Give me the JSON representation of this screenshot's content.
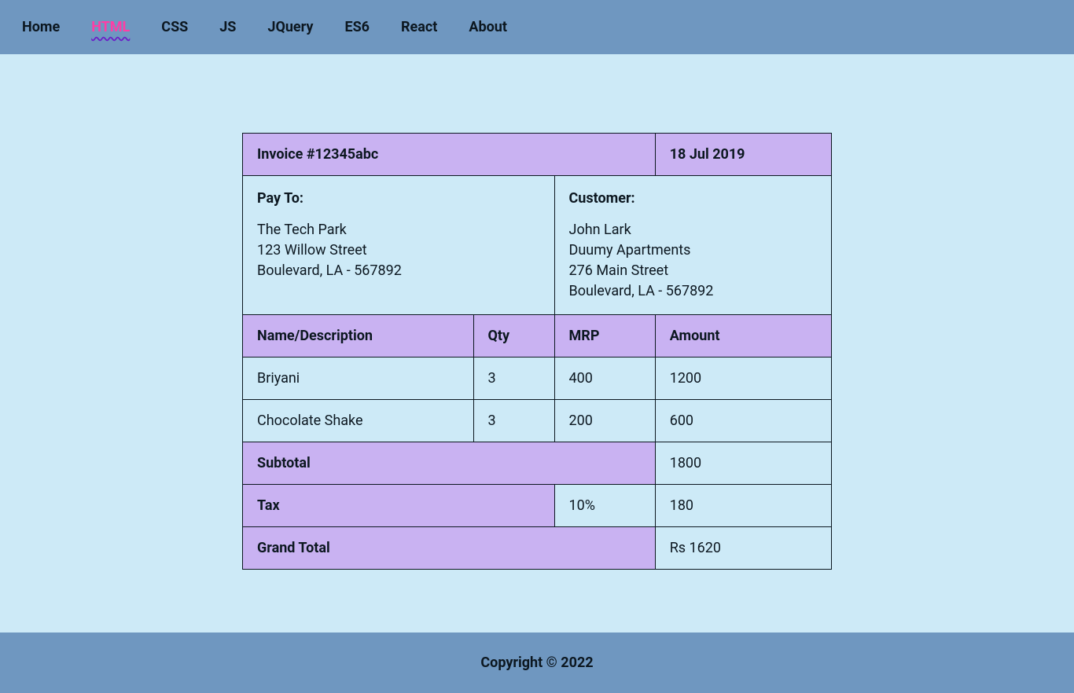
{
  "nav": {
    "items": [
      {
        "label": "Home",
        "active": false
      },
      {
        "label": "HTML",
        "active": true
      },
      {
        "label": "CSS",
        "active": false
      },
      {
        "label": "JS",
        "active": false
      },
      {
        "label": "JQuery",
        "active": false
      },
      {
        "label": "ES6",
        "active": false
      },
      {
        "label": "React",
        "active": false
      },
      {
        "label": "About",
        "active": false
      }
    ]
  },
  "invoice": {
    "title": "Invoice #12345abc",
    "date": "18 Jul 2019",
    "pay_to": {
      "heading": "Pay To:",
      "lines": "The Tech Park\n123 Willow Street\nBoulevard, LA - 567892"
    },
    "customer": {
      "heading": "Customer:",
      "lines": "John Lark\nDuumy Apartments\n276 Main Street\nBoulevard, LA - 567892"
    },
    "columns": {
      "name": "Name/Description",
      "qty": "Qty",
      "mrp": "MRP",
      "amount": "Amount"
    },
    "items": [
      {
        "name": "Briyani",
        "qty": "3",
        "mrp": "400",
        "amount": "1200"
      },
      {
        "name": "Chocolate Shake",
        "qty": "3",
        "mrp": "200",
        "amount": "600"
      }
    ],
    "subtotal": {
      "label": "Subtotal",
      "value": "1800"
    },
    "tax": {
      "label": "Tax",
      "rate": "10%",
      "value": "180"
    },
    "grand": {
      "label": "Grand Total",
      "value": "Rs 1620"
    }
  },
  "footer": {
    "text": "Copyright © 2022"
  }
}
